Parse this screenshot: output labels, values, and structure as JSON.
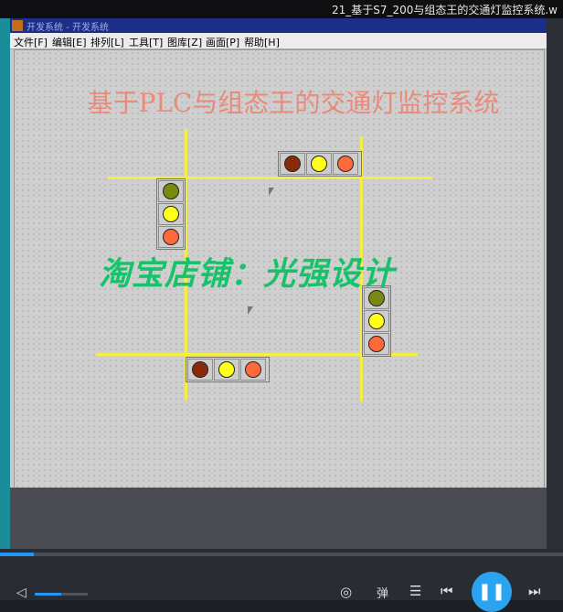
{
  "video_title": "21_基于S7_200与组态王的交通灯监控系统.w",
  "app": {
    "title": "开发系统 - 开发系统",
    "menu": [
      "文件[F]",
      "编辑[E]",
      "排列[L]",
      "工具[T]",
      "图库[Z]",
      "画面[P]",
      "帮助[H]"
    ]
  },
  "screen_title": "基于PLC与组态王的交通灯监控系统",
  "watermark": "淘宝店铺：光强设计",
  "traffic_lights": [
    {
      "id": "north",
      "orientation": "horizontal",
      "bulbs": [
        "#8b2a0a",
        "#ffff1a",
        "#ff6a3a"
      ]
    },
    {
      "id": "west",
      "orientation": "vertical",
      "bulbs": [
        "#7a8a10",
        "#ffff1a",
        "#ff6a3a"
      ]
    },
    {
      "id": "east",
      "orientation": "vertical",
      "bulbs": [
        "#7a8a10",
        "#ffff1a",
        "#ff6a3a"
      ]
    },
    {
      "id": "south",
      "orientation": "horizontal",
      "bulbs": [
        "#8b2a0a",
        "#ffff1a",
        "#ff6a3a"
      ]
    }
  ],
  "road_color": "#f7ee44",
  "player": {
    "progress_fraction": 0.06,
    "volume_fraction": 0.5,
    "danmaku_label": "弹",
    "controls": [
      "eye-icon",
      "danmaku-toggle",
      "settings-icon",
      "previous-icon",
      "pause-icon",
      "next-icon"
    ]
  }
}
